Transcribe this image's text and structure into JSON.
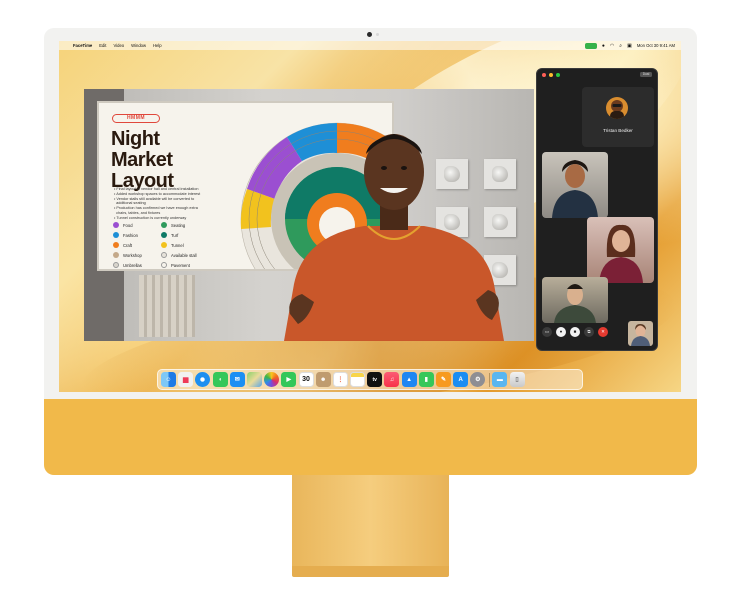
{
  "menubar": {
    "app_name": "FaceTime",
    "items": [
      "Edit",
      "Video",
      "Window",
      "Help"
    ],
    "clock": "Mon Oct 30 9:41 AM"
  },
  "presentation": {
    "badge": "HMMM",
    "title_line1": "Night Market",
    "title_line2": "Layout",
    "bullets": [
      "Final layout of vendor hall and central installation",
      "Added workshop spaces to accommodate interest",
      "Vendor stalls still available will be converted to",
      "additional seating",
      "Production has confirmed we have enough extra",
      "chairs, tables, and fixtures",
      "Tunnel construction is currently underway"
    ],
    "legend": [
      {
        "label": "Food",
        "color": "#9b4fd1"
      },
      {
        "label": "Seating",
        "color": "#2f9a5c"
      },
      {
        "label": "Fashion",
        "color": "#1e8fd6"
      },
      {
        "label": "Turf",
        "color": "#0f7a66"
      },
      {
        "label": "Craft",
        "color": "#f07d1e"
      },
      {
        "label": "Tunnel",
        "color": "#f2c21e"
      },
      {
        "label": "Workshop",
        "color": "#c4a98a"
      },
      {
        "label": "Available stall",
        "color": "#e6e2da"
      },
      {
        "label": "Umbrellas",
        "color": "#d8d4cc"
      },
      {
        "label": "Pavement",
        "color": "#f6f3ec"
      }
    ]
  },
  "facetime": {
    "chip_label": "Dual",
    "caller_name": "Tristan Bedker",
    "controls": [
      "sidebar",
      "mic",
      "video",
      "share",
      "end"
    ]
  },
  "dock": {
    "calendar_day": "30",
    "apps": [
      "finder",
      "launchpad",
      "safari",
      "messages",
      "mail",
      "maps",
      "photos",
      "facetime",
      "calendar",
      "contacts",
      "reminders",
      "notes",
      "tv",
      "music",
      "keynote",
      "numbers",
      "pages",
      "app-store",
      "system-settings",
      "downloads",
      "trash"
    ]
  }
}
